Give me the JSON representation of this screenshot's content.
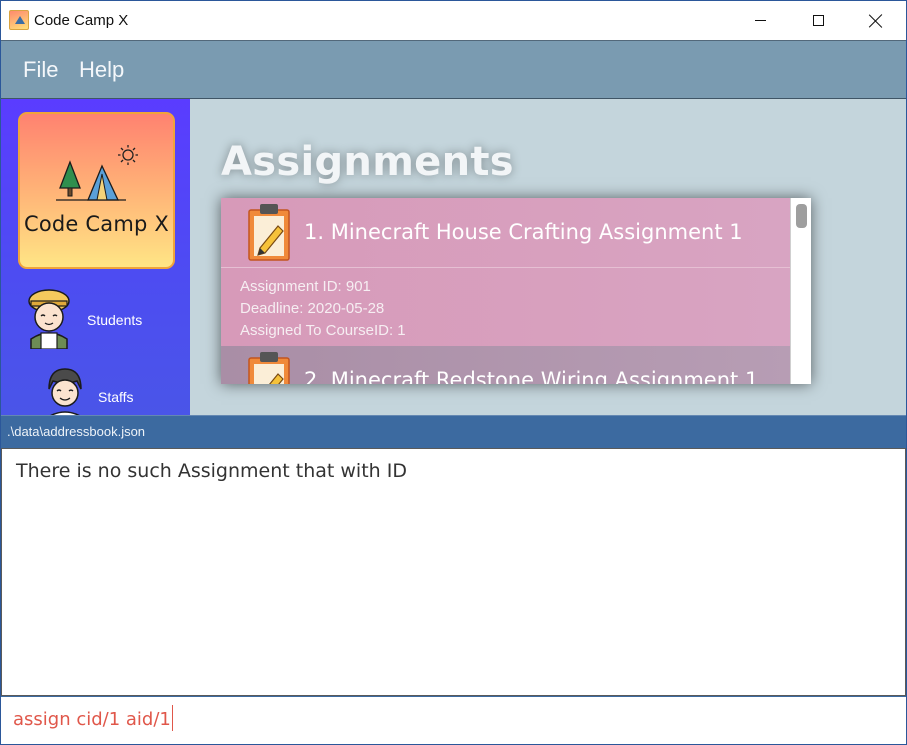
{
  "window": {
    "title": "Code Camp X",
    "minimize_icon": "minimize-icon",
    "maximize_icon": "maximize-icon",
    "close_icon": "close-icon"
  },
  "menu": {
    "items": [
      {
        "label": "File"
      },
      {
        "label": "Help"
      }
    ]
  },
  "sidebar": {
    "logo_text": "Code Camp X",
    "items": [
      {
        "label": "Students",
        "icon": "student-avatar-icon"
      },
      {
        "label": "Staffs",
        "icon": "staff-avatar-icon"
      }
    ]
  },
  "main": {
    "title": "Assignments",
    "assignments": [
      {
        "title": "1.  Minecraft House Crafting Assignment 1",
        "id_line": "Assignment ID: 901",
        "deadline_line": "Deadline: 2020-05-28",
        "course_line": "Assigned To CourseID: 1"
      },
      {
        "title": "2.  Minecraft Redstone Wiring Assignment 1"
      }
    ]
  },
  "status": {
    "path": ".\\data\\addressbook.json"
  },
  "result": {
    "message": "There is no such Assignment that with ID"
  },
  "command": {
    "value": "assign cid/1 aid/1"
  },
  "colors": {
    "menubar": "#7a9bb1",
    "sidebar": "#5a3cff",
    "main_bg": "#c4d5dc",
    "card": "#d8a4c2",
    "statusbar": "#3c6aa0",
    "command_text": "#e0574a"
  }
}
